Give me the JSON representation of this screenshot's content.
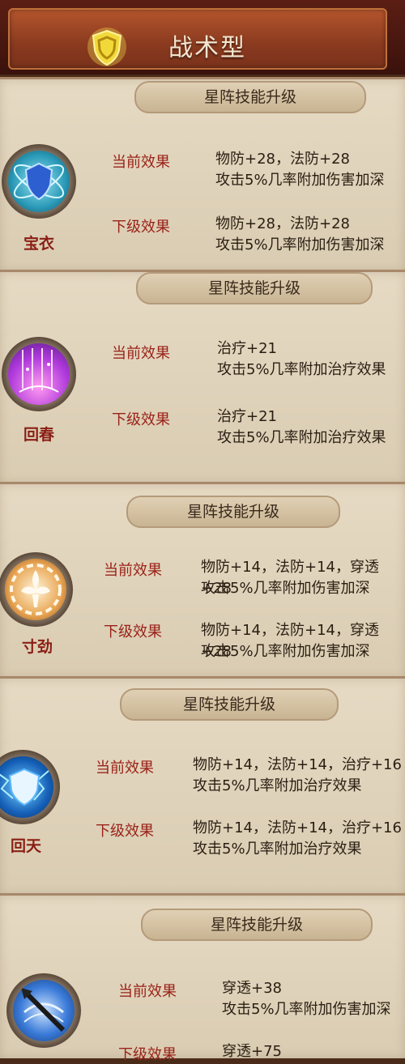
{
  "header": {
    "title": "战术型"
  },
  "banner_label": "星阵技能升级",
  "skills": [
    {
      "name": "宝衣",
      "current_label": "当前效果",
      "current_line1": "物防+28，法防+28",
      "current_line2": "攻击5%几率附加伤害加深",
      "next_label": "下级效果",
      "next_line1": "物防+28，法防+28",
      "next_line2": "攻击5%几率附加伤害加深",
      "icon": "blue-shield-icon"
    },
    {
      "name": "回春",
      "current_label": "当前效果",
      "current_line1": "治疗+21",
      "current_line2": "攻击5%几率附加治疗效果",
      "next_label": "下级效果",
      "next_line1": "治疗+21",
      "next_line2": "攻击5%几率附加治疗效果",
      "icon": "purple-light-icon"
    },
    {
      "name": "寸劲",
      "current_label": "当前效果",
      "current_line1": "物防+14，法防+14，穿透+28",
      "current_line2": "攻击5%几率附加伤害加深",
      "next_label": "下级效果",
      "next_line1": "物防+14，法防+14，穿透+28",
      "next_line2": "攻击5%几率附加伤害加深",
      "icon": "fleur-de-lis-icon"
    },
    {
      "name": "回天",
      "current_label": "当前效果",
      "current_line1": "物防+14，法防+14，治疗+16",
      "current_line2": "攻击5%几率附加治疗效果",
      "next_label": "下级效果",
      "next_line1": "物防+14，法防+14，治疗+16",
      "next_line2": "攻击5%几率附加治疗效果",
      "icon": "lightning-shield-icon"
    },
    {
      "name": "",
      "current_label": "当前效果",
      "current_line1": "穿透+38",
      "current_line2": "攻击5%几率附加伤害加深",
      "next_label": "下级效果",
      "next_line1": "穿透+75",
      "next_line2": "",
      "icon": "spear-swirl-icon"
    }
  ]
}
